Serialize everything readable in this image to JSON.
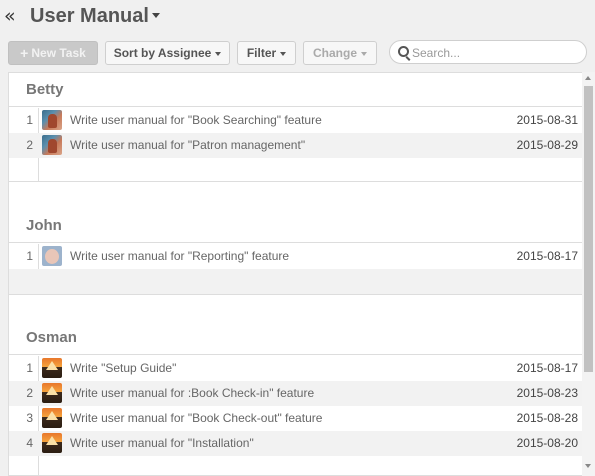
{
  "header": {
    "back_glyph": "«",
    "title": "User Manual"
  },
  "toolbar": {
    "new_task_label": "New Task",
    "sort_label": "Sort by Assignee",
    "filter_label": "Filter",
    "change_label": "Change",
    "search_placeholder": "Search..."
  },
  "groups": [
    {
      "name": "Betty",
      "avatar": "betty-avatar",
      "tasks": [
        {
          "num": "1",
          "title": "Write user manual for \"Book Searching\" feature",
          "date": "2015-08-31"
        },
        {
          "num": "2",
          "title": "Write user manual for \"Patron management\"",
          "date": "2015-08-29"
        }
      ]
    },
    {
      "name": "John",
      "avatar": "john-avatar",
      "tasks": [
        {
          "num": "1",
          "title": "Write user manual for \"Reporting\" feature",
          "date": "2015-08-17"
        }
      ]
    },
    {
      "name": "Osman",
      "avatar": "osman-avatar",
      "tasks": [
        {
          "num": "1",
          "title": "Write \"Setup Guide\"",
          "date": "2015-08-17"
        },
        {
          "num": "2",
          "title": "Write user manual for :Book Check-in\" feature",
          "date": "2015-08-23"
        },
        {
          "num": "3",
          "title": "Write user manual for \"Book Check-out\" feature",
          "date": "2015-08-28"
        },
        {
          "num": "4",
          "title": "Write user manual for \"Installation\"",
          "date": "2015-08-20"
        }
      ]
    }
  ]
}
